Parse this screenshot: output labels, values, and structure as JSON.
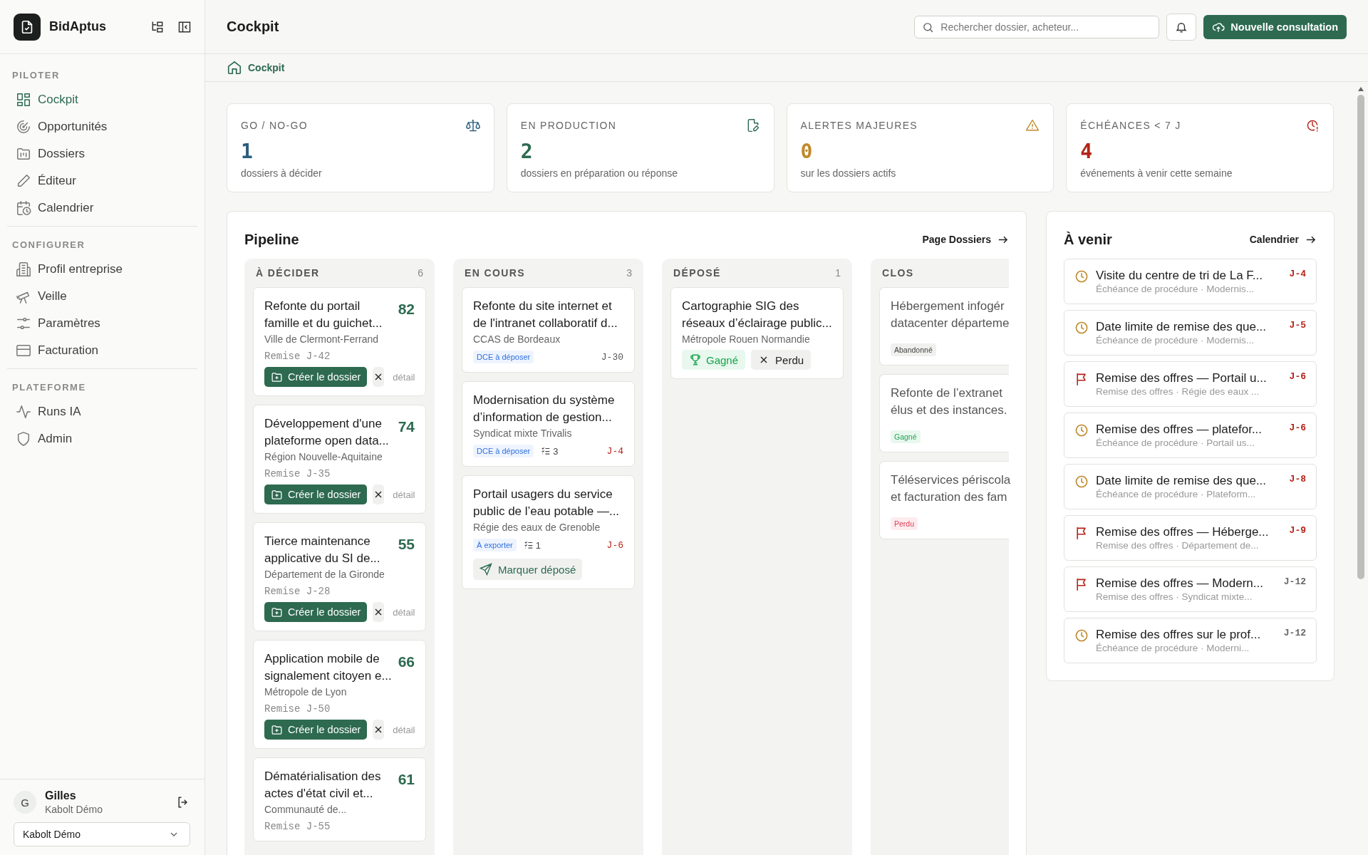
{
  "sidebar": {
    "brand": "BidAptus",
    "sections": [
      {
        "title": "PILOTER",
        "items": [
          {
            "label": "Cockpit",
            "selected": true
          },
          {
            "label": "Opportunités",
            "selected": false
          },
          {
            "label": "Dossiers",
            "selected": false
          },
          {
            "label": "Éditeur",
            "selected": false
          },
          {
            "label": "Calendrier",
            "selected": false
          }
        ]
      },
      {
        "title": "CONFIGURER",
        "items": [
          {
            "label": "Profil entreprise",
            "selected": false
          },
          {
            "label": "Veille",
            "selected": false
          },
          {
            "label": "Paramètres",
            "selected": false
          },
          {
            "label": "Facturation",
            "selected": false
          }
        ]
      },
      {
        "title": "PLATEFORME",
        "items": [
          {
            "label": "Runs IA",
            "selected": false
          },
          {
            "label": "Admin",
            "selected": false
          }
        ]
      }
    ],
    "user": {
      "initial": "G",
      "name": "Gilles",
      "org": "Kabolt Démo"
    },
    "org_select": {
      "value": "Kabolt Démo"
    }
  },
  "header": {
    "title": "Cockpit",
    "search": {
      "placeholder": "Rechercher dossier, acheteur..."
    },
    "primary_button": "Nouvelle consultation"
  },
  "breadcrumb": "Cockpit",
  "kpis": [
    {
      "label": "GO / NO-GO",
      "value": "1",
      "caption": "dossiers à décider",
      "color": "#2a5d7e"
    },
    {
      "label": "EN PRODUCTION",
      "value": "2",
      "caption": "dossiers en préparation ou réponse",
      "color": "#2d6a50"
    },
    {
      "label": "ALERTES MAJEURES",
      "value": "0",
      "caption": "sur les dossiers actifs",
      "color": "#c0892b"
    },
    {
      "label": "ÉCHÉANCES < 7 J",
      "value": "4",
      "caption": "événements à venir cette semaine",
      "color": "#b42318"
    }
  ],
  "pipeline": {
    "title": "Pipeline",
    "link": "Page Dossiers",
    "columns": [
      {
        "kind": "decide",
        "title": "À DÉCIDER",
        "count": "6",
        "cards": [
          {
            "title": "Refonte du portail famille et du guichet...",
            "buyer": "Ville de Clermont-Ferrand",
            "score": "82",
            "deadline": "Remise J-42",
            "action": "Créer le dossier",
            "secondary": "détail"
          },
          {
            "title": "Développement d'une plateforme open data...",
            "buyer": "Région Nouvelle-Aquitaine",
            "score": "74",
            "deadline": "Remise J-35",
            "action": "Créer le dossier",
            "secondary": "détail"
          },
          {
            "title": "Tierce maintenance applicative du SI de...",
            "buyer": "Département de la Gironde",
            "score": "55",
            "deadline": "Remise J-28",
            "action": "Créer le dossier",
            "secondary": "détail"
          },
          {
            "title": "Application mobile de signalement citoyen e...",
            "buyer": "Métropole de Lyon",
            "score": "66",
            "deadline": "Remise J-50",
            "action": "Créer le dossier",
            "secondary": "détail"
          },
          {
            "title": "Dématérialisation des actes d'état civil et...",
            "buyer": "Communauté de...",
            "score": "61",
            "deadline": "Remise J-55"
          }
        ]
      },
      {
        "kind": "progress",
        "title": "EN COURS",
        "count": "3",
        "cards": [
          {
            "title": "Refonte du site internet et de l'intranet collaboratif d...",
            "buyer": "CCAS de Bordeaux",
            "tag": "DCE à déposer",
            "due": "J-30",
            "urgent": false
          },
          {
            "title": "Modernisation du système d’information de gestion...",
            "buyer": "Syndicat mixte Trivalis",
            "tag": "DCE à déposer",
            "tasks": "3",
            "due": "J-4",
            "urgent": true
          },
          {
            "title": "Portail usagers du service public de l’eau potable —...",
            "buyer": "Régie des eaux de Grenoble",
            "tag": "À exporter",
            "tasks": "1",
            "due": "J-6",
            "urgent": true,
            "action": "Marquer déposé"
          }
        ]
      },
      {
        "kind": "submitted",
        "title": "DÉPOSÉ",
        "count": "1",
        "cards": [
          {
            "title": "Cartographie SIG des réseaux d’éclairage public...",
            "buyer": "Métropole Rouen Normandie",
            "won": "Gagné",
            "lost": "Perdu"
          }
        ]
      },
      {
        "kind": "closed",
        "title": "CLOS",
        "cards": [
          {
            "title_lines": [
              "Hébergement infogér",
              "datacenter départeme"
            ],
            "status": "Abandonné",
            "kind": "abandoned"
          },
          {
            "title_lines": [
              "Refonte de l’extranet",
              "élus et des instances."
            ],
            "status": "Gagné",
            "kind": "won"
          },
          {
            "title_lines": [
              "Téléservices périscola",
              "et facturation des fam"
            ],
            "status": "Perdu",
            "kind": "lost"
          }
        ]
      }
    ]
  },
  "upcoming": {
    "title": "À venir",
    "link": "Calendrier",
    "items": [
      {
        "kind": "deadline",
        "title": "Visite du centre de tri de La F...",
        "subtitle": "Échéance de procédure · Modernis...",
        "due": "J-4",
        "urgent": true
      },
      {
        "kind": "deadline",
        "title": "Date limite de remise des que...",
        "subtitle": "Échéance de procédure · Modernis...",
        "due": "J-5",
        "urgent": true
      },
      {
        "kind": "submission",
        "title": "Remise des offres — Portail u...",
        "subtitle": "Remise des offres · Régie des eaux ...",
        "due": "J-6",
        "urgent": true
      },
      {
        "kind": "deadline",
        "title": "Remise des offres — platefor...",
        "subtitle": "Échéance de procédure · Portail us...",
        "due": "J-6",
        "urgent": true
      },
      {
        "kind": "deadline",
        "title": "Date limite de remise des que...",
        "subtitle": "Échéance de procédure · Plateform...",
        "due": "J-8",
        "urgent": true
      },
      {
        "kind": "submission",
        "title": "Remise des offres — Héberge...",
        "subtitle": "Remise des offres · Département de...",
        "due": "J-9",
        "urgent": true
      },
      {
        "kind": "submission",
        "title": "Remise des offres — Modern...",
        "subtitle": "Remise des offres · Syndicat mixte...",
        "due": "J-12",
        "urgent": false
      },
      {
        "kind": "deadline",
        "title": "Remise des offres sur le prof...",
        "subtitle": "Échéance de procédure · Moderni...",
        "due": "J-12",
        "urgent": false
      }
    ]
  }
}
